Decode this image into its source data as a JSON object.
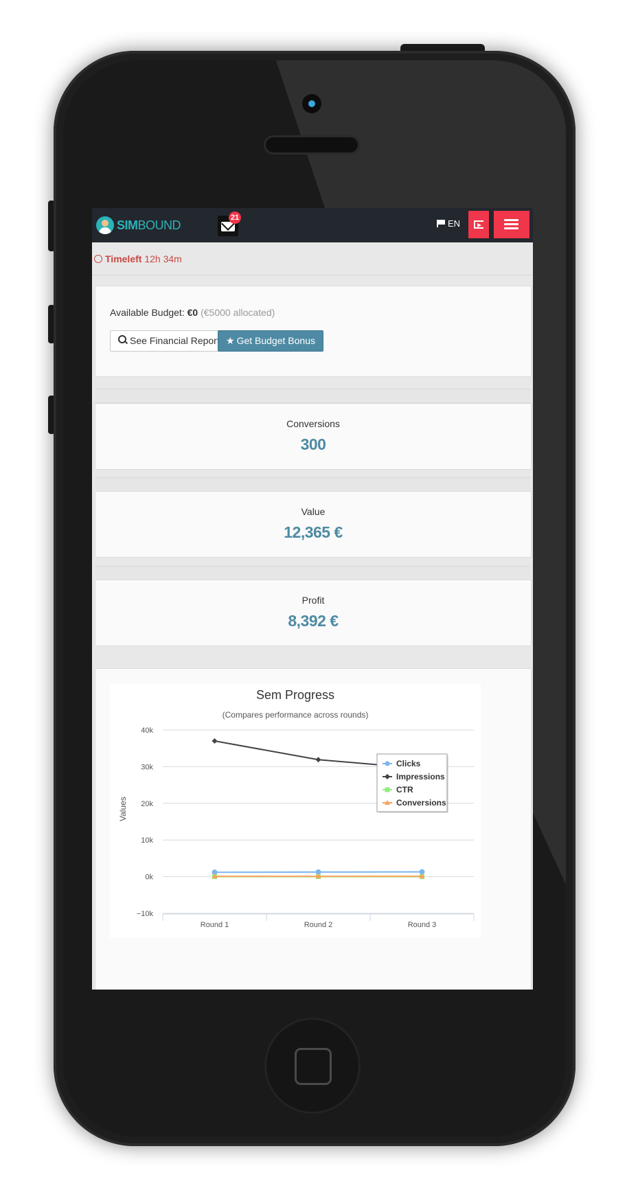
{
  "navbar": {
    "logo": {
      "part1": "SIM",
      "part2": "BOUND"
    },
    "message_count": "21",
    "language": "EN"
  },
  "timeleft": {
    "label": "Timeleft",
    "value": "12h 34m"
  },
  "budget": {
    "label": "Available Budget:",
    "amount": "€0",
    "allocated": "(€5000 allocated)",
    "financial_report_label": "See Financial Report",
    "bonus_label": "Get Budget Bonus"
  },
  "stats": [
    {
      "label": "Conversions",
      "value": "300"
    },
    {
      "label": "Value",
      "value": "12,365 €"
    },
    {
      "label": "Profit",
      "value": "8,392 €"
    }
  ],
  "colors": {
    "accent": "#4e8aa3",
    "danger": "#f0364a",
    "navbar": "#23272e",
    "timeleft": "#c94743"
  },
  "chart_data": {
    "type": "line",
    "title": "Sem Progress",
    "subtitle": "(Compares performance across rounds)",
    "ylabel": "Values",
    "xlabel": "",
    "categories": [
      "Round 1",
      "Round 2",
      "Round 3"
    ],
    "ylim": [
      -10000,
      40000
    ],
    "yticks": [
      -10000,
      0,
      10000,
      20000,
      30000,
      40000
    ],
    "ytick_labels": [
      "−10k",
      "0k",
      "10k",
      "20k",
      "30k",
      "40k"
    ],
    "legend_position": "top-right",
    "grid": true,
    "series": [
      {
        "name": "Clicks",
        "color": "#7cb5ec",
        "marker": "circle",
        "values": [
          1200,
          1250,
          1300
        ]
      },
      {
        "name": "Impressions",
        "color": "#434348",
        "marker": "diamond",
        "values": [
          37000,
          31900,
          29500
        ]
      },
      {
        "name": "CTR",
        "color": "#90ed7d",
        "marker": "square",
        "values": [
          4,
          4,
          4
        ]
      },
      {
        "name": "Conversions",
        "color": "#f7a35c",
        "marker": "triangle",
        "values": [
          100,
          100,
          100
        ]
      }
    ]
  }
}
